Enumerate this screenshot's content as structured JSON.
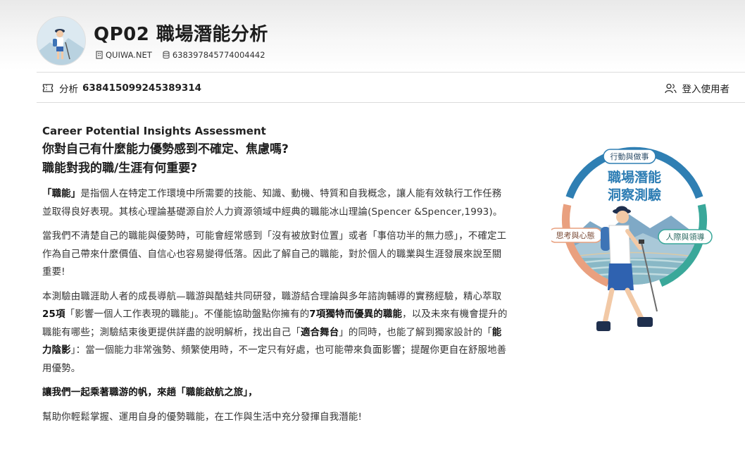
{
  "header": {
    "title": "QP02 職場潛能分析",
    "site": "QUIWA.NET",
    "id": "638397845774004442"
  },
  "infobar": {
    "analysis_label": "分析",
    "analysis_id": "638415099245389314",
    "login_label": "登入使用者"
  },
  "content": {
    "subtitle": "Career Potential Insights Assessment",
    "heading_line1": "你對自己有什麼能力優勢感到不確定、焦慮嗎?",
    "heading_line2": "職能對我的職/生涯有何重要?",
    "p1": {
      "bold": "「職能」",
      "rest": "是指個人在特定工作環境中所需要的技能、知識、動機、特質和自我概念，讓人能有效執行工作任務並取得良好表現。其核心理論基礎源自於人力資源領域中經典的職能冰山理論(Spencer &Spencer,1993)。"
    },
    "p2": "當我們不清楚自己的職能與優勢時，可能會經常感到「沒有被放對位置」或者「事倍功半的無力感」，不確定工作為自己帶來什麼價值、自信心也容易變得低落。因此了解自己的職能，對於個人的職業與生涯發展來說至關重要!",
    "p3": {
      "t1": "本測驗由職涯助人者的成長導航—職游與酷蛙共同研發，職游結合理論與多年諮詢輔導的實務經驗，精心萃取",
      "b1": "25項",
      "t2": "「影響一個人工作表現的職能」。不僅能協助盤點你擁有的",
      "b2": "7項獨特而優異的職能",
      "t3": "，以及未來有機會提升的職能有哪些；測驗結束後更提供詳盡的說明解析，找出自己「",
      "b3": "適合舞台",
      "t4": "」的同時，也能了解到獨家設計的「",
      "b4": "能力陰影",
      "t5": "」：當一個能力非常強勢、頻繁使用時，不一定只有好處，也可能帶來負面影響；提醒你更自在舒服地善用優勢。"
    },
    "p4": "讓我們一起乘著職游的帆，來趟「職能啟航之旅」，",
    "p5": "幫助你輕鬆掌握、運用自身的優勢職能，在工作與生活中充分發揮自我潛能!"
  },
  "illustration": {
    "title_line1": "職場潛能",
    "title_line2": "洞察測驗",
    "tag_top": "行動與做事",
    "tag_left": "思考與心態",
    "tag_right": "人際與領導"
  },
  "colors": {
    "ring_blue": "#2f7fb3",
    "ring_teal": "#3aa89a",
    "ring_salmon": "#e9a07f",
    "title_blue": "#2d7db4"
  }
}
